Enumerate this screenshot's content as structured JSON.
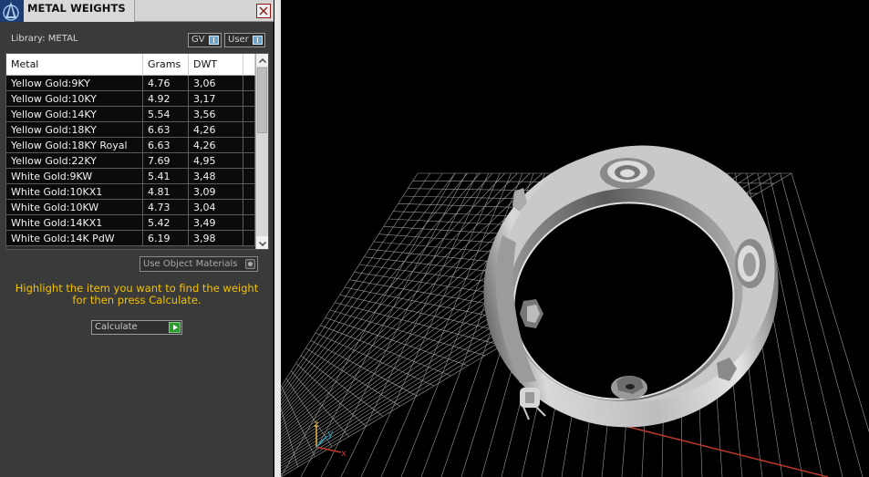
{
  "panel": {
    "title": "METAL WEIGHTS",
    "library_label": "Library: METAL",
    "toggles": [
      {
        "label": "GV"
      },
      {
        "label": "User"
      }
    ],
    "table": {
      "columns": [
        "Metal",
        "Grams",
        "DWT"
      ],
      "rows": [
        {
          "metal": "Yellow Gold:9KY",
          "grams": "4.76",
          "dwt": "3,06"
        },
        {
          "metal": "Yellow Gold:10KY",
          "grams": "4.92",
          "dwt": "3,17"
        },
        {
          "metal": "Yellow Gold:14KY",
          "grams": "5.54",
          "dwt": "3,56"
        },
        {
          "metal": "Yellow Gold:18KY",
          "grams": "6.63",
          "dwt": "4,26"
        },
        {
          "metal": "Yellow Gold:18KY Royal",
          "grams": "6.63",
          "dwt": "4,26"
        },
        {
          "metal": "Yellow Gold:22KY",
          "grams": "7.69",
          "dwt": "4,95"
        },
        {
          "metal": "White Gold:9KW",
          "grams": "5.41",
          "dwt": "3,48"
        },
        {
          "metal": "White Gold:10KX1",
          "grams": "4.81",
          "dwt": "3,09"
        },
        {
          "metal": "White Gold:10KW",
          "grams": "4.73",
          "dwt": "3,04"
        },
        {
          "metal": "White Gold:14KX1",
          "grams": "5.42",
          "dwt": "3,49"
        },
        {
          "metal": "White Gold:14K PdW",
          "grams": "6.19",
          "dwt": "3,98"
        }
      ]
    },
    "use_object_materials": "Use Object Materials",
    "hint": "Highlight the item you want to find the weight for then press Calculate.",
    "calculate_label": "Calculate"
  },
  "viewport": {
    "axis_labels": {
      "z": "z",
      "y": "y",
      "x": "x"
    },
    "colors": {
      "grid": "#9a9a9a",
      "x_axis": "#c0392b",
      "y_axis": "#2aa7c9",
      "z_axis": "#e8b84a",
      "background": "#000000"
    }
  },
  "colors": {
    "panel_bg": "#3a3a3a",
    "hint_text": "#f2c200",
    "row_bg": "#0b0b0b"
  }
}
